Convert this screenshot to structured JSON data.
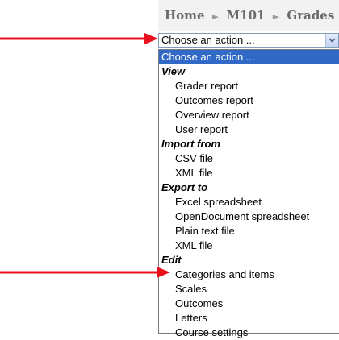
{
  "breadcrumb": {
    "items": [
      "Home",
      "M101",
      "Grades"
    ]
  },
  "select": {
    "value": "Choose an action ..."
  },
  "dropdown": {
    "selected": "Choose an action ...",
    "groups": [
      {
        "label": "View",
        "items": [
          "Grader report",
          "Outcomes report",
          "Overview report",
          "User report"
        ]
      },
      {
        "label": "Import from",
        "items": [
          "CSV file",
          "XML file"
        ]
      },
      {
        "label": "Export to",
        "items": [
          "Excel spreadsheet",
          "OpenDocument spreadsheet",
          "Plain text file",
          "XML file"
        ]
      },
      {
        "label": "Edit",
        "items": [
          "Categories and items",
          "Scales",
          "Outcomes",
          "Letters",
          "Course settings"
        ]
      }
    ]
  },
  "colors": {
    "annotation_arrow": "#e8101a",
    "highlight": "#3169c6"
  }
}
